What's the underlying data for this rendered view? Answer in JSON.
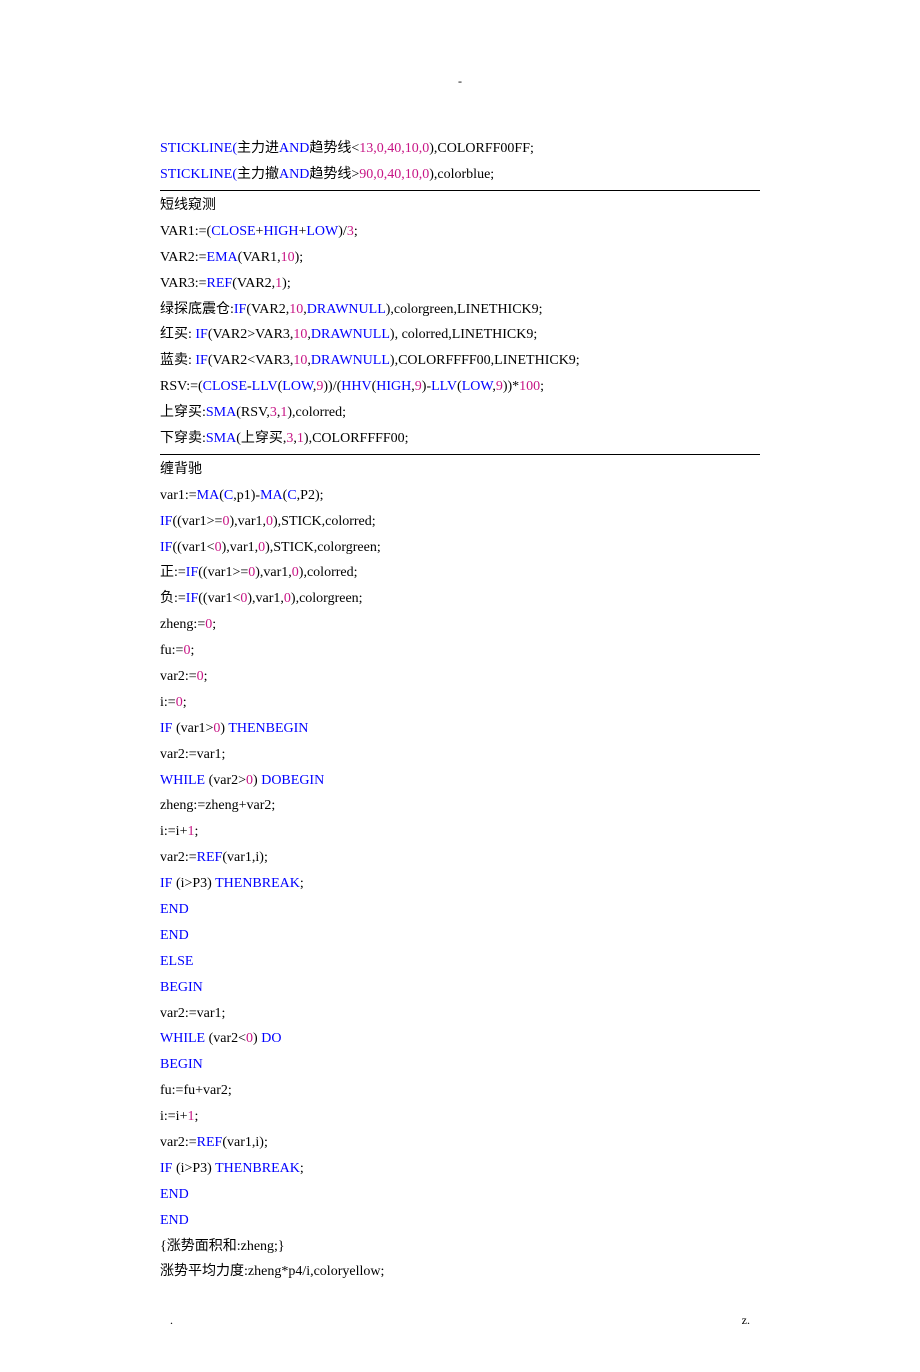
{
  "header": {
    "mark": "-"
  },
  "footer": {
    "left": ".",
    "right": "z."
  },
  "lines": [
    {
      "segments": [
        {
          "t": "STICKLINE(",
          "c": "kw"
        },
        {
          "t": "主力进",
          "c": "blk"
        },
        {
          "t": "AND",
          "c": "kw"
        },
        {
          "t": "趋势线<",
          "c": "blk"
        },
        {
          "t": "13,0,40,10,0",
          "c": "num"
        },
        {
          "t": "),COLORFF00FF;",
          "c": "blk"
        }
      ]
    },
    {
      "segments": [
        {
          "t": "STICKLINE(",
          "c": "kw"
        },
        {
          "t": "主力撤",
          "c": "blk"
        },
        {
          "t": "AND",
          "c": "kw"
        },
        {
          "t": "趋势线>",
          "c": "blk"
        },
        {
          "t": "90,0,40,10,0",
          "c": "num"
        },
        {
          "t": "),colorblue;",
          "c": "blk"
        }
      ]
    },
    {
      "hr": true
    },
    {
      "segments": [
        {
          "t": "短线窥测",
          "c": "blk"
        }
      ]
    },
    {
      "segments": [
        {
          "t": "VAR1:=(",
          "c": "blk"
        },
        {
          "t": "CLOSE",
          "c": "kw"
        },
        {
          "t": "+",
          "c": "blk"
        },
        {
          "t": "HIGH",
          "c": "kw"
        },
        {
          "t": "+",
          "c": "blk"
        },
        {
          "t": "LOW",
          "c": "kw"
        },
        {
          "t": ")/",
          "c": "blk"
        },
        {
          "t": "3",
          "c": "num"
        },
        {
          "t": ";",
          "c": "blk"
        }
      ]
    },
    {
      "segments": [
        {
          "t": "VAR2:=",
          "c": "blk"
        },
        {
          "t": "EMA",
          "c": "kw"
        },
        {
          "t": "(VAR1,",
          "c": "blk"
        },
        {
          "t": "10",
          "c": "num"
        },
        {
          "t": ");",
          "c": "blk"
        }
      ]
    },
    {
      "segments": [
        {
          "t": "VAR3:=",
          "c": "blk"
        },
        {
          "t": "REF",
          "c": "kw"
        },
        {
          "t": "(VAR2,",
          "c": "blk"
        },
        {
          "t": "1",
          "c": "num"
        },
        {
          "t": ");",
          "c": "blk"
        }
      ]
    },
    {
      "segments": [
        {
          "t": "绿探底震仓:",
          "c": "blk"
        },
        {
          "t": "IF",
          "c": "kw"
        },
        {
          "t": "(VAR2,",
          "c": "blk"
        },
        {
          "t": "10",
          "c": "num"
        },
        {
          "t": ",",
          "c": "blk"
        },
        {
          "t": "DRAWNULL",
          "c": "kw"
        },
        {
          "t": "),colorgreen,LINETHICK9;",
          "c": "blk"
        }
      ]
    },
    {
      "segments": [
        {
          "t": "红买: ",
          "c": "blk"
        },
        {
          "t": "IF",
          "c": "kw"
        },
        {
          "t": "(VAR2>VAR3,",
          "c": "blk"
        },
        {
          "t": "10",
          "c": "num"
        },
        {
          "t": ",",
          "c": "blk"
        },
        {
          "t": "DRAWNULL",
          "c": "kw"
        },
        {
          "t": "), colorred,LINETHICK9;",
          "c": "blk"
        }
      ]
    },
    {
      "segments": [
        {
          "t": "蓝卖: ",
          "c": "blk"
        },
        {
          "t": "IF",
          "c": "kw"
        },
        {
          "t": "(VAR2<VAR3,",
          "c": "blk"
        },
        {
          "t": "10",
          "c": "num"
        },
        {
          "t": ",",
          "c": "blk"
        },
        {
          "t": "DRAWNULL",
          "c": "kw"
        },
        {
          "t": "),COLORFFFF00,LINETHICK9;",
          "c": "blk"
        }
      ]
    },
    {
      "segments": [
        {
          "t": "RSV:=(",
          "c": "blk"
        },
        {
          "t": "CLOSE",
          "c": "kw"
        },
        {
          "t": "-",
          "c": "blk"
        },
        {
          "t": "LLV",
          "c": "kw"
        },
        {
          "t": "(",
          "c": "blk"
        },
        {
          "t": "LOW",
          "c": "kw"
        },
        {
          "t": ",",
          "c": "blk"
        },
        {
          "t": "9",
          "c": "num"
        },
        {
          "t": "))/(",
          "c": "blk"
        },
        {
          "t": "HHV",
          "c": "kw"
        },
        {
          "t": "(",
          "c": "blk"
        },
        {
          "t": "HIGH",
          "c": "kw"
        },
        {
          "t": ",",
          "c": "blk"
        },
        {
          "t": "9",
          "c": "num"
        },
        {
          "t": ")-",
          "c": "blk"
        },
        {
          "t": "LLV",
          "c": "kw"
        },
        {
          "t": "(",
          "c": "blk"
        },
        {
          "t": "LOW",
          "c": "kw"
        },
        {
          "t": ",",
          "c": "blk"
        },
        {
          "t": "9",
          "c": "num"
        },
        {
          "t": "))*",
          "c": "blk"
        },
        {
          "t": "100",
          "c": "num"
        },
        {
          "t": ";",
          "c": "blk"
        }
      ]
    },
    {
      "segments": [
        {
          "t": "上穿买:",
          "c": "blk"
        },
        {
          "t": "SMA",
          "c": "kw"
        },
        {
          "t": "(RSV,",
          "c": "blk"
        },
        {
          "t": "3",
          "c": "num"
        },
        {
          "t": ",",
          "c": "blk"
        },
        {
          "t": "1",
          "c": "num"
        },
        {
          "t": "),colorred;",
          "c": "blk"
        }
      ]
    },
    {
      "segments": [
        {
          "t": "下穿卖:",
          "c": "blk"
        },
        {
          "t": "SMA",
          "c": "kw"
        },
        {
          "t": "(上穿买,",
          "c": "blk"
        },
        {
          "t": "3",
          "c": "num"
        },
        {
          "t": ",",
          "c": "blk"
        },
        {
          "t": "1",
          "c": "num"
        },
        {
          "t": "),COLORFFFF00;",
          "c": "blk"
        }
      ]
    },
    {
      "hr": true
    },
    {
      "segments": [
        {
          "t": "缠背驰",
          "c": "blk"
        }
      ]
    },
    {
      "segments": [
        {
          "t": "var1:=",
          "c": "blk"
        },
        {
          "t": "MA",
          "c": "kw"
        },
        {
          "t": "(",
          "c": "blk"
        },
        {
          "t": "C",
          "c": "kw"
        },
        {
          "t": ",p1)-",
          "c": "blk"
        },
        {
          "t": "MA",
          "c": "kw"
        },
        {
          "t": "(",
          "c": "blk"
        },
        {
          "t": "C",
          "c": "kw"
        },
        {
          "t": ",P2);",
          "c": "blk"
        }
      ]
    },
    {
      "segments": [
        {
          "t": "IF",
          "c": "kw"
        },
        {
          "t": "((var1>=",
          "c": "blk"
        },
        {
          "t": "0",
          "c": "num"
        },
        {
          "t": "),var1,",
          "c": "blk"
        },
        {
          "t": "0",
          "c": "num"
        },
        {
          "t": "),STICK,colorred;",
          "c": "blk"
        }
      ]
    },
    {
      "segments": [
        {
          "t": "IF",
          "c": "kw"
        },
        {
          "t": "((var1<",
          "c": "blk"
        },
        {
          "t": "0",
          "c": "num"
        },
        {
          "t": "),var1,",
          "c": "blk"
        },
        {
          "t": "0",
          "c": "num"
        },
        {
          "t": "),STICK,colorgreen;",
          "c": "blk"
        }
      ]
    },
    {
      "segments": [
        {
          "t": "正:=",
          "c": "blk"
        },
        {
          "t": "IF",
          "c": "kw"
        },
        {
          "t": "((var1>=",
          "c": "blk"
        },
        {
          "t": "0",
          "c": "num"
        },
        {
          "t": "),var1,",
          "c": "blk"
        },
        {
          "t": "0",
          "c": "num"
        },
        {
          "t": "),colorred;",
          "c": "blk"
        }
      ]
    },
    {
      "segments": [
        {
          "t": "负:=",
          "c": "blk"
        },
        {
          "t": "IF",
          "c": "kw"
        },
        {
          "t": "((var1<",
          "c": "blk"
        },
        {
          "t": "0",
          "c": "num"
        },
        {
          "t": "),var1,",
          "c": "blk"
        },
        {
          "t": "0",
          "c": "num"
        },
        {
          "t": "),colorgreen;",
          "c": "blk"
        }
      ]
    },
    {
      "segments": [
        {
          "t": "zheng:=",
          "c": "blk"
        },
        {
          "t": "0",
          "c": "num"
        },
        {
          "t": ";",
          "c": "blk"
        }
      ]
    },
    {
      "segments": [
        {
          "t": "fu:=",
          "c": "blk"
        },
        {
          "t": "0",
          "c": "num"
        },
        {
          "t": ";",
          "c": "blk"
        }
      ]
    },
    {
      "segments": [
        {
          "t": "var2:=",
          "c": "blk"
        },
        {
          "t": "0",
          "c": "num"
        },
        {
          "t": ";",
          "c": "blk"
        }
      ]
    },
    {
      "segments": [
        {
          "t": "i:=",
          "c": "blk"
        },
        {
          "t": "0",
          "c": "num"
        },
        {
          "t": ";",
          "c": "blk"
        }
      ]
    },
    {
      "segments": [
        {
          "t": "IF",
          "c": "kw"
        },
        {
          "t": " (var1>",
          "c": "blk"
        },
        {
          "t": "0",
          "c": "num"
        },
        {
          "t": ") ",
          "c": "blk"
        },
        {
          "t": "THENBEGIN",
          "c": "kw"
        }
      ]
    },
    {
      "segments": [
        {
          "t": "var2:=var1;",
          "c": "blk"
        }
      ]
    },
    {
      "segments": [
        {
          "t": "WHILE",
          "c": "kw"
        },
        {
          "t": " (var2>",
          "c": "blk"
        },
        {
          "t": "0",
          "c": "num"
        },
        {
          "t": ") ",
          "c": "blk"
        },
        {
          "t": "DOBEGIN",
          "c": "kw"
        }
      ]
    },
    {
      "segments": [
        {
          "t": "zheng:=zheng+var2;",
          "c": "blk"
        }
      ]
    },
    {
      "segments": [
        {
          "t": "i:=i+",
          "c": "blk"
        },
        {
          "t": "1",
          "c": "num"
        },
        {
          "t": ";",
          "c": "blk"
        }
      ]
    },
    {
      "segments": [
        {
          "t": "var2:=",
          "c": "blk"
        },
        {
          "t": "REF",
          "c": "kw"
        },
        {
          "t": "(var1,i);",
          "c": "blk"
        }
      ]
    },
    {
      "segments": [
        {
          "t": "IF",
          "c": "kw"
        },
        {
          "t": " (i>P3) ",
          "c": "blk"
        },
        {
          "t": "THENBREAK",
          "c": "kw"
        },
        {
          "t": ";",
          "c": "blk"
        }
      ]
    },
    {
      "segments": [
        {
          "t": "END",
          "c": "kw"
        }
      ]
    },
    {
      "segments": [
        {
          "t": "END",
          "c": "kw"
        }
      ]
    },
    {
      "segments": [
        {
          "t": "ELSE",
          "c": "kw"
        }
      ]
    },
    {
      "segments": [
        {
          "t": "BEGIN",
          "c": "kw"
        }
      ]
    },
    {
      "segments": [
        {
          "t": "var2:=var1;",
          "c": "blk"
        }
      ]
    },
    {
      "segments": [
        {
          "t": "WHILE",
          "c": "kw"
        },
        {
          "t": " (var2<",
          "c": "blk"
        },
        {
          "t": "0",
          "c": "num"
        },
        {
          "t": ") ",
          "c": "blk"
        },
        {
          "t": "DO",
          "c": "kw"
        }
      ]
    },
    {
      "segments": [
        {
          "t": "BEGIN",
          "c": "kw"
        }
      ]
    },
    {
      "segments": [
        {
          "t": "fu:=fu+var2;",
          "c": "blk"
        }
      ]
    },
    {
      "segments": [
        {
          "t": "i:=i+",
          "c": "blk"
        },
        {
          "t": "1",
          "c": "num"
        },
        {
          "t": ";",
          "c": "blk"
        }
      ]
    },
    {
      "segments": [
        {
          "t": "var2:=",
          "c": "blk"
        },
        {
          "t": "REF",
          "c": "kw"
        },
        {
          "t": "(var1,i);",
          "c": "blk"
        }
      ]
    },
    {
      "segments": [
        {
          "t": "IF",
          "c": "kw"
        },
        {
          "t": " (i>P3) ",
          "c": "blk"
        },
        {
          "t": "THENBREAK",
          "c": "kw"
        },
        {
          "t": ";",
          "c": "blk"
        }
      ]
    },
    {
      "segments": [
        {
          "t": "END",
          "c": "kw"
        }
      ]
    },
    {
      "segments": [
        {
          "t": "END",
          "c": "kw"
        }
      ]
    },
    {
      "segments": [
        {
          "t": "{涨势面积和:zheng;}",
          "c": "blk"
        }
      ]
    },
    {
      "segments": [
        {
          "t": "涨势平均力度:zheng*p4/i,coloryellow;",
          "c": "blk"
        }
      ]
    }
  ]
}
